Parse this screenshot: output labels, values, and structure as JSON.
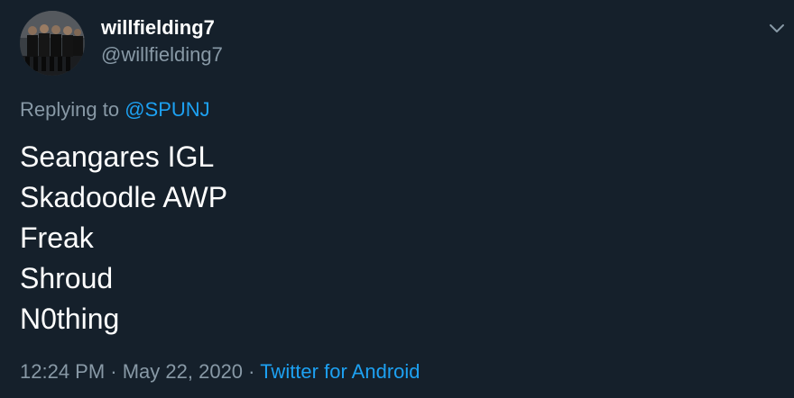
{
  "user": {
    "display_name": "willfielding7",
    "handle": "@willfielding7"
  },
  "reply": {
    "prefix": "Replying to ",
    "mention": "@SPUNJ"
  },
  "tweet_lines": [
    "Seangares IGL",
    "Skadoodle AWP",
    "Freak",
    "Shroud",
    "N0thing"
  ],
  "meta": {
    "time": "12:24 PM",
    "separator1": " · ",
    "date": "May 22, 2020",
    "separator2": " · ",
    "source": "Twitter for Android"
  },
  "icons": {
    "menu": "chevron-down-icon",
    "avatar": "group-photo-avatar"
  },
  "colors": {
    "background": "#15202b",
    "primary_text": "#ffffff",
    "secondary_text": "#8899a6",
    "link": "#1da1f2"
  }
}
